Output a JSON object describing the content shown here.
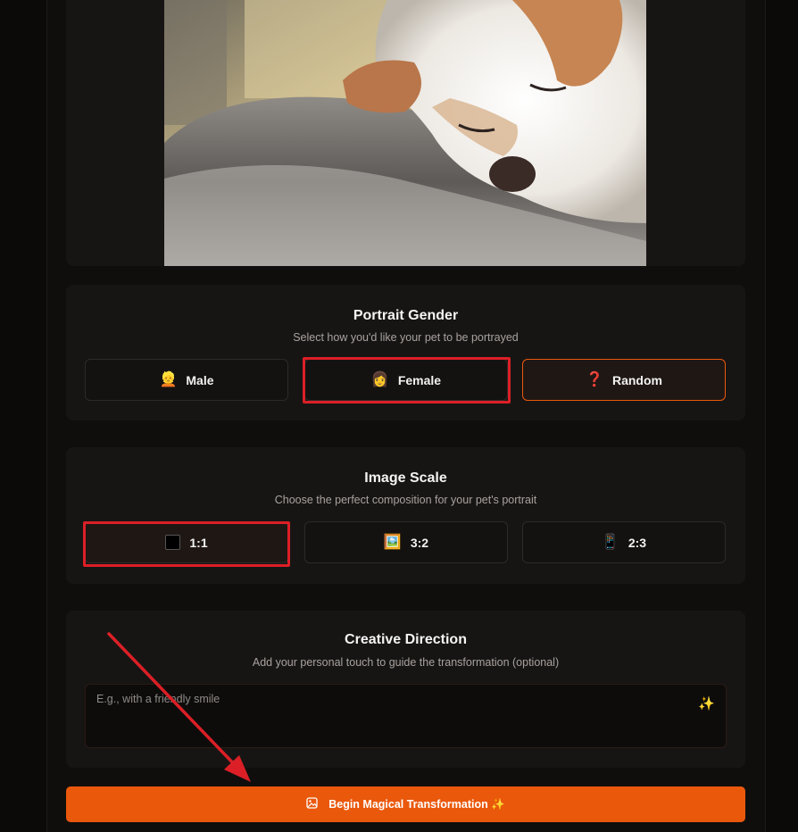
{
  "gender": {
    "title": "Portrait Gender",
    "subtitle": "Select how you'd like your pet to be portrayed",
    "options": [
      {
        "icon": "👱",
        "icon_name": "man-emoji-icon",
        "label": "Male"
      },
      {
        "icon": "👩",
        "icon_name": "woman-emoji-icon",
        "label": "Female"
      },
      {
        "icon": "❓",
        "icon_name": "question-mark-icon",
        "label": "Random"
      }
    ],
    "selected": "Random"
  },
  "scale": {
    "title": "Image Scale",
    "subtitle": "Choose the perfect composition for your pet's portrait",
    "options": [
      {
        "icon": "⬛",
        "icon_name": "square-icon",
        "label": "1:1"
      },
      {
        "icon": "🖼️",
        "icon_name": "landscape-picture-icon",
        "label": "3:2"
      },
      {
        "icon": "📱",
        "icon_name": "phone-portrait-icon",
        "label": "2:3"
      }
    ],
    "selected": "1:1"
  },
  "direction": {
    "title": "Creative Direction",
    "subtitle": "Add your personal touch to guide the transformation (optional)",
    "placeholder": "E.g., with a friendly smile",
    "sparkle_icon": "✨"
  },
  "cta": {
    "label": "Begin Magical Transformation ✨",
    "icon_name": "image-icon"
  },
  "colors": {
    "accent": "#ea580c",
    "annotation": "#dc1f26",
    "card": "#171514",
    "background": "#0b0a09"
  }
}
